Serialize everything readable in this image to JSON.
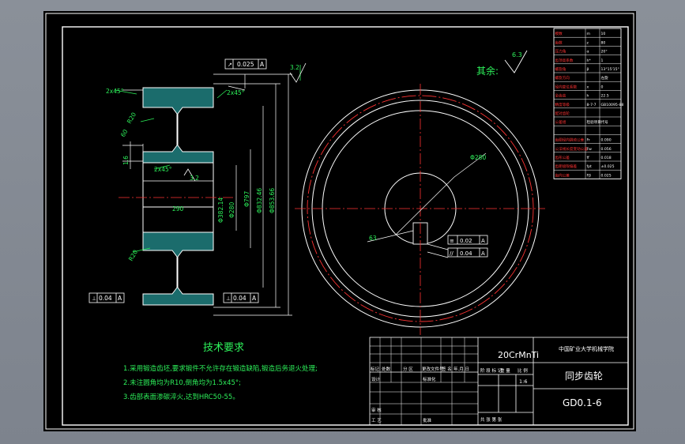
{
  "drawing": {
    "surface_roughness_other": "其余:",
    "surface_roughness_other_value": "6.3",
    "roughness_top": "3.2",
    "roughness_bore": "3.2",
    "runout_tolerance": "0.025",
    "datum_a": "A",
    "chamfer_top_left": "2x45°",
    "chamfer_top_right": "2x45°",
    "chamfer_web": "2x45°",
    "radius_top": "R20",
    "radius_bottom": "R20",
    "dim_60": "60",
    "dim_16": "1.6",
    "dim_width": "290",
    "dim_bore": "Φ280",
    "dim_hub": "Φ382.14",
    "dim_root": "Φ797",
    "dim_pitch": "Φ832.46",
    "dim_outer": "Φ853.66",
    "dim_bore_front": "Φ280",
    "dim_keyway": "63",
    "perp_left": "0.04",
    "perp_right": "0.04",
    "sym_tol": "0.02",
    "par_tol": "0.04",
    "tech_title": "技术要求",
    "tech_notes": [
      "1.采用锻造齿坯,要求锻件不允许存在锻造缺陷,锻造后务退火处理;",
      "2.未注圆角均为R10,倒角均为1.5x45°;",
      "3.齿部表面渗碳淬火,达到HRC50-55。"
    ]
  },
  "param_table": {
    "rows": [
      [
        "模数",
        "m",
        "10"
      ],
      [
        "齿数",
        "z",
        "80"
      ],
      [
        "压力角",
        "α",
        "20°"
      ],
      [
        "齿顶高系数",
        "h*",
        "1"
      ],
      [
        "螺旋角",
        "β",
        "13°15'15\""
      ],
      [
        "螺旋方向",
        "",
        "左旋"
      ],
      [
        "径向变位系数",
        "x",
        "0"
      ],
      [
        "全齿高",
        "h",
        "22.5"
      ],
      [
        "精度等级",
        "8-7-7",
        "GB10095-88"
      ],
      [
        "配对齿轮",
        "",
        ""
      ],
      [
        "公差组",
        "检验项目",
        "代号"
      ],
      [
        "",
        "",
        ""
      ],
      [
        "齿圈径向跳动公差",
        "Fr",
        "0.090"
      ],
      [
        "公法线长度变动公差",
        "Fw",
        "0.056"
      ],
      [
        "齿形公差",
        "ff",
        "0.018"
      ],
      [
        "齿距极限偏差",
        "fpt",
        "±0.025"
      ],
      [
        "齿向公差",
        "Fβ",
        "0.025"
      ]
    ]
  },
  "title_block": {
    "material": "20CrMnTi",
    "school": "中国矿业大学机械学院",
    "part_name": "同步齿轮",
    "drawing_no": "GD0.1-6",
    "scale": "1:6",
    "labels": {
      "mark": "标记",
      "count": "处数",
      "zone": "分 区",
      "change_doc": "更改文件号",
      "sign": "签 名",
      "date": "年.月.日",
      "design": "设计",
      "standard": "标准化",
      "stage": "阶 段 标 记",
      "weight": "重 量",
      "ratio": "比 例",
      "review": "审 核",
      "process": "工 艺",
      "approve": "批准",
      "sheets": "共 张 第 张"
    }
  }
}
